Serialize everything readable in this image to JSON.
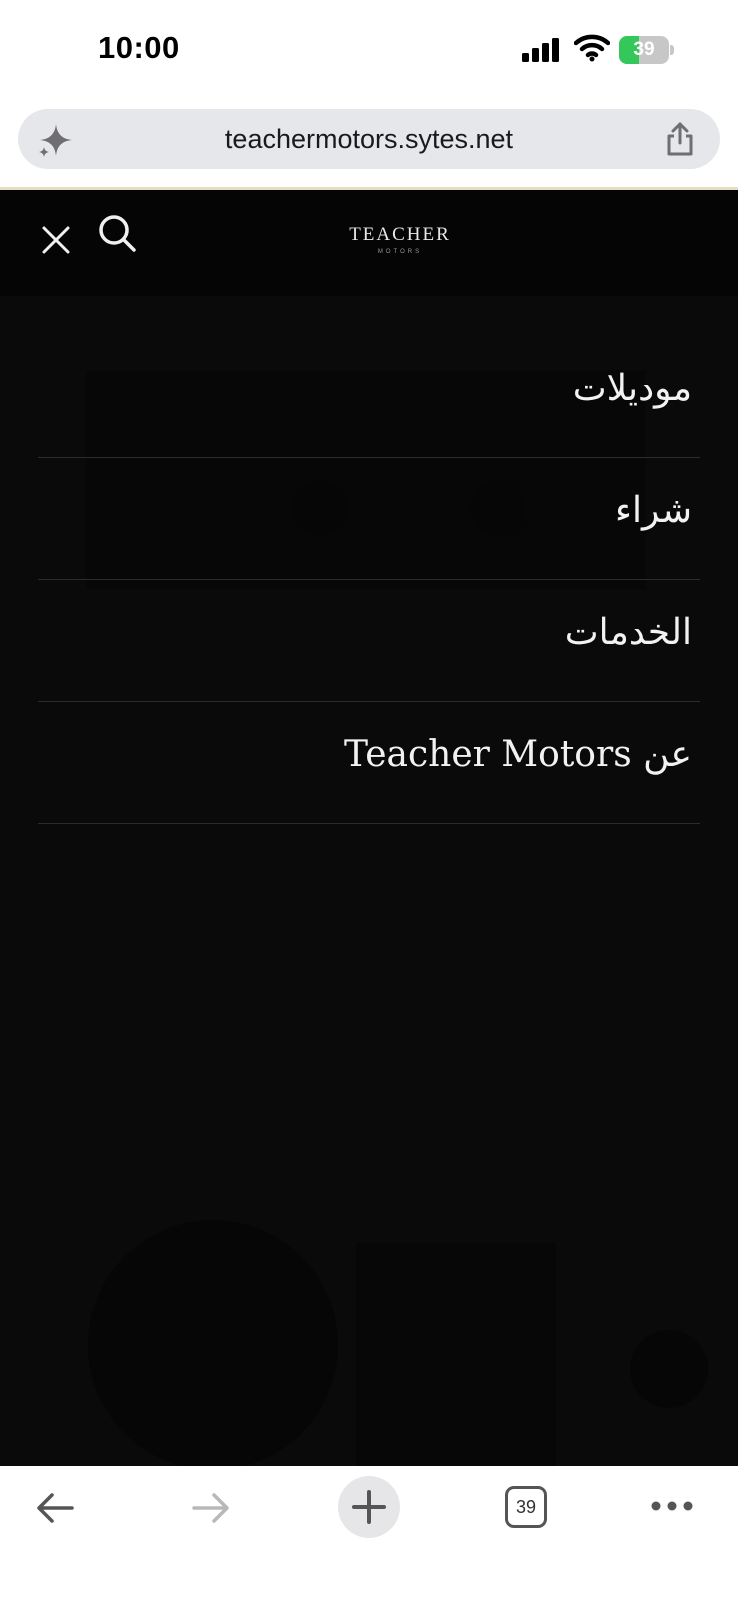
{
  "status_bar": {
    "time": "10:00",
    "battery_level": "39",
    "battery_percent": 39,
    "battery_color": "#34c759"
  },
  "browser": {
    "url": "teachermotors.sytes.net",
    "tab_count": "39",
    "icons": {
      "left": "sparkle-icon",
      "right": "share-icon"
    }
  },
  "header": {
    "logo_main": "TEACHER",
    "logo_sub": "MOTORS",
    "icons": [
      "close-icon",
      "search-icon"
    ]
  },
  "menu": {
    "items": [
      {
        "label": "موديلات"
      },
      {
        "label": "شراء"
      },
      {
        "label": "الخدمات"
      },
      {
        "label": "عن Teacher Motors"
      }
    ]
  },
  "toolbar": {
    "icons": [
      "back-arrow-icon",
      "forward-arrow-icon",
      "plus-icon",
      "tabs-icon",
      "more-icon"
    ]
  },
  "colors": {
    "page_background": "#0a0a0a",
    "header_background": "#050505",
    "menu_text": "#f2f2f2",
    "divider": "#2c2c2c",
    "accent_line": "#e6dcc3"
  }
}
